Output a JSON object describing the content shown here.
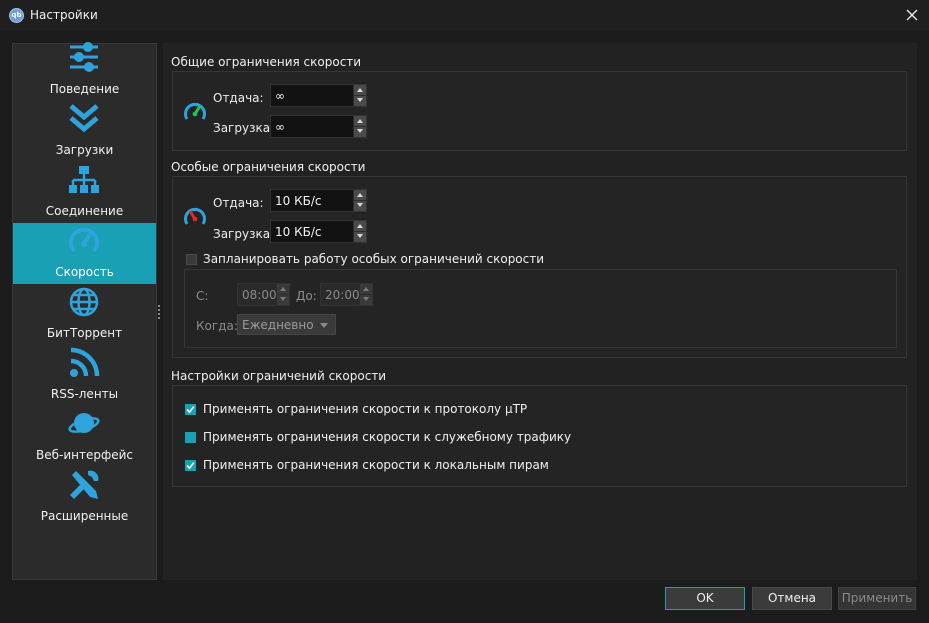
{
  "window": {
    "title": "Настройки",
    "icon_text": "qb"
  },
  "sidebar": {
    "items": [
      {
        "label": "Поведение",
        "icon": "sliders-icon"
      },
      {
        "label": "Загрузки",
        "icon": "double-chevron-down-icon"
      },
      {
        "label": "Соединение",
        "icon": "network-icon"
      },
      {
        "label": "Скорость",
        "icon": "speedometer-icon",
        "active": true
      },
      {
        "label": "БитТоррент",
        "icon": "globe-icon"
      },
      {
        "label": "RSS-ленты",
        "icon": "rss-icon"
      },
      {
        "label": "Веб-интерфейс",
        "icon": "planet-icon"
      },
      {
        "label": "Расширенные",
        "icon": "tools-icon"
      }
    ]
  },
  "global_limits": {
    "title": "Общие ограничения скорости",
    "upload_label": "Отдача:",
    "upload_value": "∞",
    "download_label": "Загрузка:",
    "download_value": "∞"
  },
  "alt_limits": {
    "title": "Особые ограничения скорости",
    "upload_label": "Отдача:",
    "upload_value": "10 КБ/с",
    "download_label": "Загрузка:",
    "download_value": "10 КБ/с",
    "schedule_label": "Запланировать работу особых ограничений скорости",
    "schedule_checked": false,
    "from_label": "С:",
    "from_value": "08:00",
    "to_label": "До:",
    "to_value": "20:00",
    "when_label": "Когда:",
    "when_value": "Ежедневно"
  },
  "settings": {
    "title": "Настройки ограничений скорости",
    "utp_label": "Применять ограничения скорости к протоколу µTP",
    "utp_checked": true,
    "overhead_label": "Применять ограничения скорости к служебному трафику",
    "overhead_checked": "partial",
    "lan_label": "Применять ограничения скорости к локальным пирам",
    "lan_checked": true
  },
  "buttons": {
    "ok": "OK",
    "cancel": "Отмена",
    "apply": "Применить"
  },
  "colors": {
    "accent": "#1aa0b4",
    "gauge_green": "#22c45a",
    "gauge_red": "#e02a2a"
  }
}
